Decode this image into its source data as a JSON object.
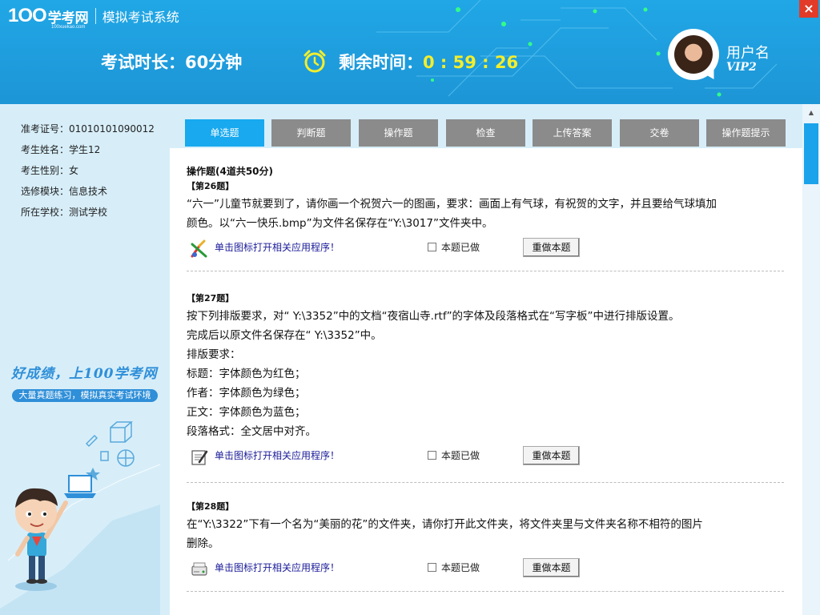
{
  "header": {
    "logo_mark": "1OO",
    "logo_cn": "学考网",
    "logo_sub": "100xuekao.com",
    "system_title": "模拟考试系统",
    "duration_label": "考试时长：60分钟",
    "remain_label": "剩余时间：",
    "remain_time": "0 : 59 : 26",
    "close_label": "×",
    "username": "用户名",
    "vip": "VIP2"
  },
  "sidebar": {
    "info": [
      {
        "label": "准考证号：",
        "value": "01010101090012"
      },
      {
        "label": "考生姓名：",
        "value": "学生12"
      },
      {
        "label": "考生性别：",
        "value": "女"
      },
      {
        "label": "选修模块：",
        "value": "信息技术"
      },
      {
        "label": "所在学校：",
        "value": "测试学校"
      }
    ],
    "slogan": "好成绩，上100学考网",
    "slogan_sub": "大量真题练习，模拟真实考试环境"
  },
  "tabs": [
    "单选题",
    "判断题",
    "操作题",
    "检查",
    "上传答案",
    "交卷",
    "操作题提示"
  ],
  "active_tab": 0,
  "main": {
    "section_title": "操作题(4道共50分)",
    "questions": [
      {
        "no": "【第26题】",
        "lines": [
          "“六一”儿童节就要到了，请你画一个祝贺六一的图画，要求：画面上有气球，有祝贺的文字，并且要给气球填加",
          "颜色。以“六一快乐.bmp”为文件名保存在“Y:\\3017”文件夹中。"
        ],
        "icon": "paint-icon",
        "link": "单击图标打开相关应用程序！",
        "done": "本题已做",
        "redo": "重做本题"
      },
      {
        "no": "【第27题】",
        "lines": [
          "按下列排版要求，对“ Y:\\3352”中的文档“夜宿山寺.rtf”的字体及段落格式在“写字板”中进行排版设置。",
          "完成后以原文件名保存在“ Y:\\3352”中。",
          "排版要求：",
          "标题：字体颜色为红色；",
          "作者：字体颜色为绿色；",
          "正文：字体颜色为蓝色；",
          "段落格式：全文居中对齐。"
        ],
        "icon": "wordpad-icon",
        "link": "单击图标打开相关应用程序！",
        "done": "本题已做",
        "redo": "重做本题"
      },
      {
        "no": "【第28题】",
        "lines": [
          "在“Y:\\3322”下有一个名为“美丽的花”的文件夹，请你打开此文件夹，将文件夹里与文件夹名称不相符的图片",
          "删除。"
        ],
        "icon": "drive-icon",
        "link": "单击图标打开相关应用程序！",
        "done": "本题已做",
        "redo": "重做本题"
      }
    ]
  },
  "colors": {
    "header_blue": "#1d9de0",
    "active_tab": "#18a9ef",
    "tab_gray": "#8b8b8b",
    "time_yellow": "#f3ee2c",
    "sidebar_bg": "#d7eef9"
  }
}
